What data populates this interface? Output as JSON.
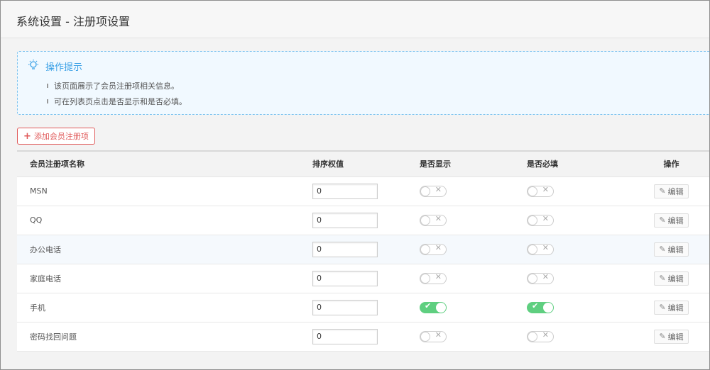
{
  "page": {
    "title": "系统设置 - 注册项设置"
  },
  "tip": {
    "title": "操作提示",
    "lines": [
      "该页面展示了会员注册项相关信息。",
      "可在列表页点击是否显示和是否必填。"
    ]
  },
  "add_button": {
    "label": "添加会员注册项"
  },
  "table": {
    "headers": {
      "name": "会员注册项名称",
      "sort": "排序权值",
      "show": "是否显示",
      "required": "是否必填",
      "op": "操作"
    },
    "rows": [
      {
        "name": "MSN",
        "sort": "0",
        "show": false,
        "required": false,
        "edit": "编辑"
      },
      {
        "name": "QQ",
        "sort": "0",
        "show": false,
        "required": false,
        "edit": "编辑"
      },
      {
        "name": "办公电话",
        "sort": "0",
        "show": false,
        "required": false,
        "edit": "编辑"
      },
      {
        "name": "家庭电话",
        "sort": "0",
        "show": false,
        "required": false,
        "edit": "编辑"
      },
      {
        "name": "手机",
        "sort": "0",
        "show": true,
        "required": true,
        "edit": "编辑"
      },
      {
        "name": "密码找回问题",
        "sort": "0",
        "show": false,
        "required": false,
        "edit": "编辑"
      }
    ]
  },
  "colors": {
    "accent": "#3aa0e6",
    "danger": "#e05a5a",
    "toggle_on": "#5fcf80"
  }
}
